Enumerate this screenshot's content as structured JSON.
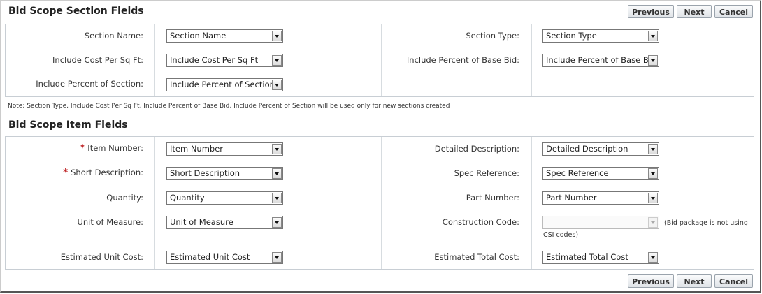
{
  "buttons": {
    "previous": "Previous",
    "next": "Next",
    "cancel": "Cancel"
  },
  "section_fields": {
    "title": "Bid Scope Section Fields",
    "rows": [
      {
        "label": "Section Name:",
        "value": "Section Name"
      },
      {
        "label": "Include Cost Per Sq Ft:",
        "value": "Include Cost Per Sq Ft"
      },
      {
        "label": "Include Percent of Section:",
        "value": "Include Percent of Section"
      },
      {
        "label": "Section Type:",
        "value": "Section Type"
      },
      {
        "label": "Include Percent of Base Bid:",
        "value": "Include Percent of Base Bid"
      }
    ],
    "note": "Note: Section Type, Include Cost Per Sq Ft, Include Percent of Base Bid, Include Percent of Section will be used only for new sections created"
  },
  "item_fields": {
    "title": "Bid Scope Item Fields",
    "required_marker": "*",
    "rows": [
      {
        "label": "Item Number:",
        "value": "Item Number",
        "required": true
      },
      {
        "label": "Short Description:",
        "value": "Short Description",
        "required": true
      },
      {
        "label": "Quantity:",
        "value": "Quantity"
      },
      {
        "label": "Unit of Measure:",
        "value": "Unit of Measure"
      },
      {
        "label": "Estimated Unit Cost:",
        "value": "Estimated Unit Cost"
      },
      {
        "label": "Detailed Description:",
        "value": "Detailed Description"
      },
      {
        "label": "Spec Reference:",
        "value": "Spec Reference"
      },
      {
        "label": "Part Number:",
        "value": "Part Number"
      },
      {
        "label": "Construction Code:",
        "value": "",
        "disabled": true
      },
      {
        "label": "Estimated Total Cost:",
        "value": "Estimated Total Cost"
      }
    ],
    "construction_hint_line1": "(Bid package is not using",
    "construction_hint_line2": "CSI codes)"
  }
}
